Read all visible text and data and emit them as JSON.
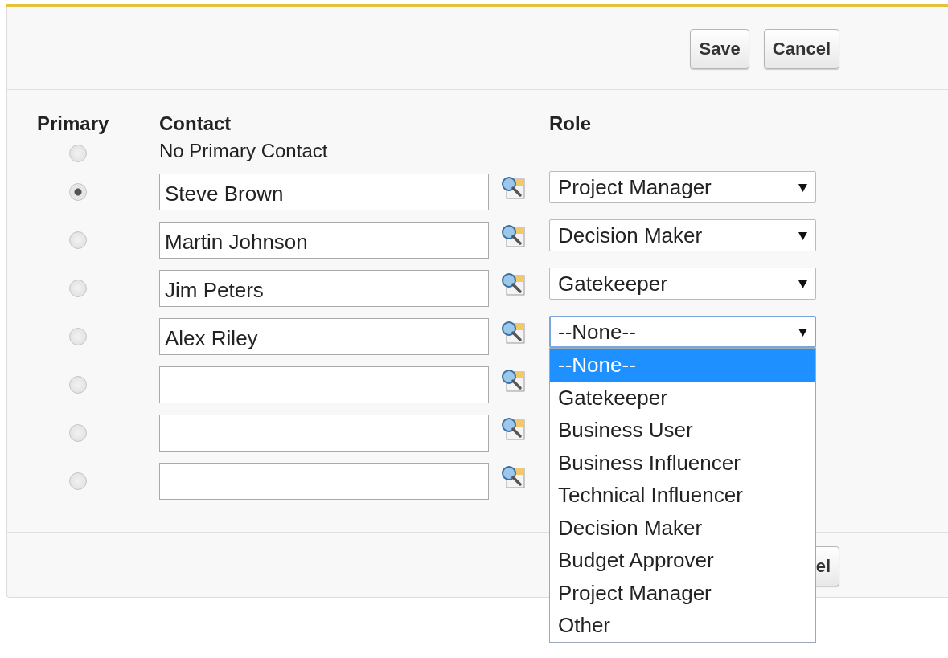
{
  "toolbar": {
    "buttons": [
      "Save",
      "Cancel"
    ]
  },
  "columns": [
    "Primary",
    "Contact",
    "Role"
  ],
  "no_primary": {
    "label": "No Primary Contact",
    "selected": false
  },
  "rows": [
    {
      "selected": true,
      "contact": "Steve Brown",
      "role": "Project Manager",
      "open": false
    },
    {
      "selected": false,
      "contact": "Martin Johnson",
      "role": "Decision Maker",
      "open": false
    },
    {
      "selected": false,
      "contact": "Jim Peters",
      "role": "Gatekeeper",
      "open": false
    },
    {
      "selected": false,
      "contact": "Alex Riley",
      "role": "--None--",
      "open": true
    },
    {
      "selected": false
    },
    {
      "selected": false
    },
    {
      "selected": false
    }
  ],
  "dropdown": {
    "options": [
      {
        "label": "--None--",
        "selected": true
      },
      {
        "label": "Gatekeeper",
        "selected": false
      },
      {
        "label": "Business User",
        "selected": false
      },
      {
        "label": "Business Influencer",
        "selected": false
      },
      {
        "label": "Technical Influencer",
        "selected": false
      },
      {
        "label": "Decision Maker",
        "selected": false
      },
      {
        "label": "Budget Approver",
        "selected": false
      },
      {
        "label": "Project Manager",
        "selected": false
      },
      {
        "label": "Other",
        "selected": false
      }
    ]
  },
  "footer": {
    "buttons": [
      "el"
    ]
  }
}
